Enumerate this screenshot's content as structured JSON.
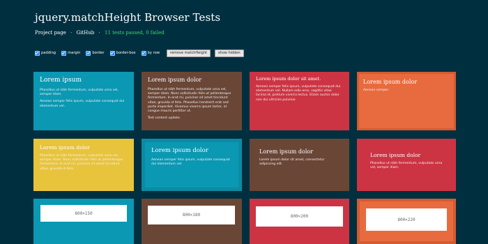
{
  "header": {
    "title": "jquery.matchHeight Browser Tests",
    "link_project": "Project page",
    "separator": "·",
    "link_github": "GitHub",
    "status": "11 tests passed, 0 failed"
  },
  "controls": {
    "checkboxes": [
      {
        "label": "padding",
        "checked": true
      },
      {
        "label": "margin",
        "checked": true
      },
      {
        "label": "border",
        "checked": true
      },
      {
        "label": "border-box",
        "checked": true
      },
      {
        "label": "by row",
        "checked": true
      }
    ],
    "remove_button": "remove matchHeight",
    "show_hidden_button": "show hidden"
  },
  "rows": [
    [
      {
        "title": "Lorem ipsum",
        "paras": [
          "Phasellus ut nibh fermentum, vulputate urna vel, semper diam.",
          "Aenean semper felis ipsum, vulputate consequat dui elementum vel."
        ]
      },
      {
        "title": "Lorem ipsum dolor",
        "paras": [
          "Phasellus ut nibh fermentum, vulputate urna vel, semper diam. Nunc sollicitudin felis ut pellentesque fermentum. In erat mi, pulvinar sit amet tincidunt vitae, gravida id felis. Phasellus hendrerit erat sed porta imperdiet. Vivamus viverra ipsum tortor, id congue mauris porttitor ut.",
          "Test content update."
        ]
      },
      {
        "title": "Lorem ipsum dolor sit amet.",
        "paras": [
          "Aenean semper felis ipsum, vulputate consequat dui elementum vel. Nullam odio eros, sagittis vitae lacinia id, pretium viverra lectus. Etiam auctor dolor non dui ultricies pulvinar."
        ]
      },
      {
        "title": "Lorem ipsum dolor",
        "paras": [
          "Aenean semper."
        ]
      }
    ],
    [
      {
        "title": "Lorem ipsum dolor",
        "paras": [
          "Phasellus ut nibh fermentum, vulputate urna vel, semper diam. Nunc sollicitudin felis ut pellentesque fermentum. In erat mi, pulvinar sit amet tincidunt vitae, gravida id felis."
        ]
      },
      {
        "title": "Lorem ipsum dolor",
        "paras": [
          "Aenean semper felis ipsum, vulputate consequat dui elementum vel."
        ]
      },
      {
        "title": "Lorem ipsum dolor",
        "paras": [
          "Lorem ipsum dolor sit amet, consectetur adipiscing elit."
        ]
      },
      {
        "title": "Lorem ipsum dolor",
        "paras": [
          "Phasellus ut nibh fermentum, vulputate urna vel, semper diam."
        ]
      }
    ],
    [
      {
        "label": "800×150"
      },
      {
        "label": "800×180"
      },
      {
        "label": "800×200"
      },
      {
        "label": "800×220"
      }
    ]
  ]
}
